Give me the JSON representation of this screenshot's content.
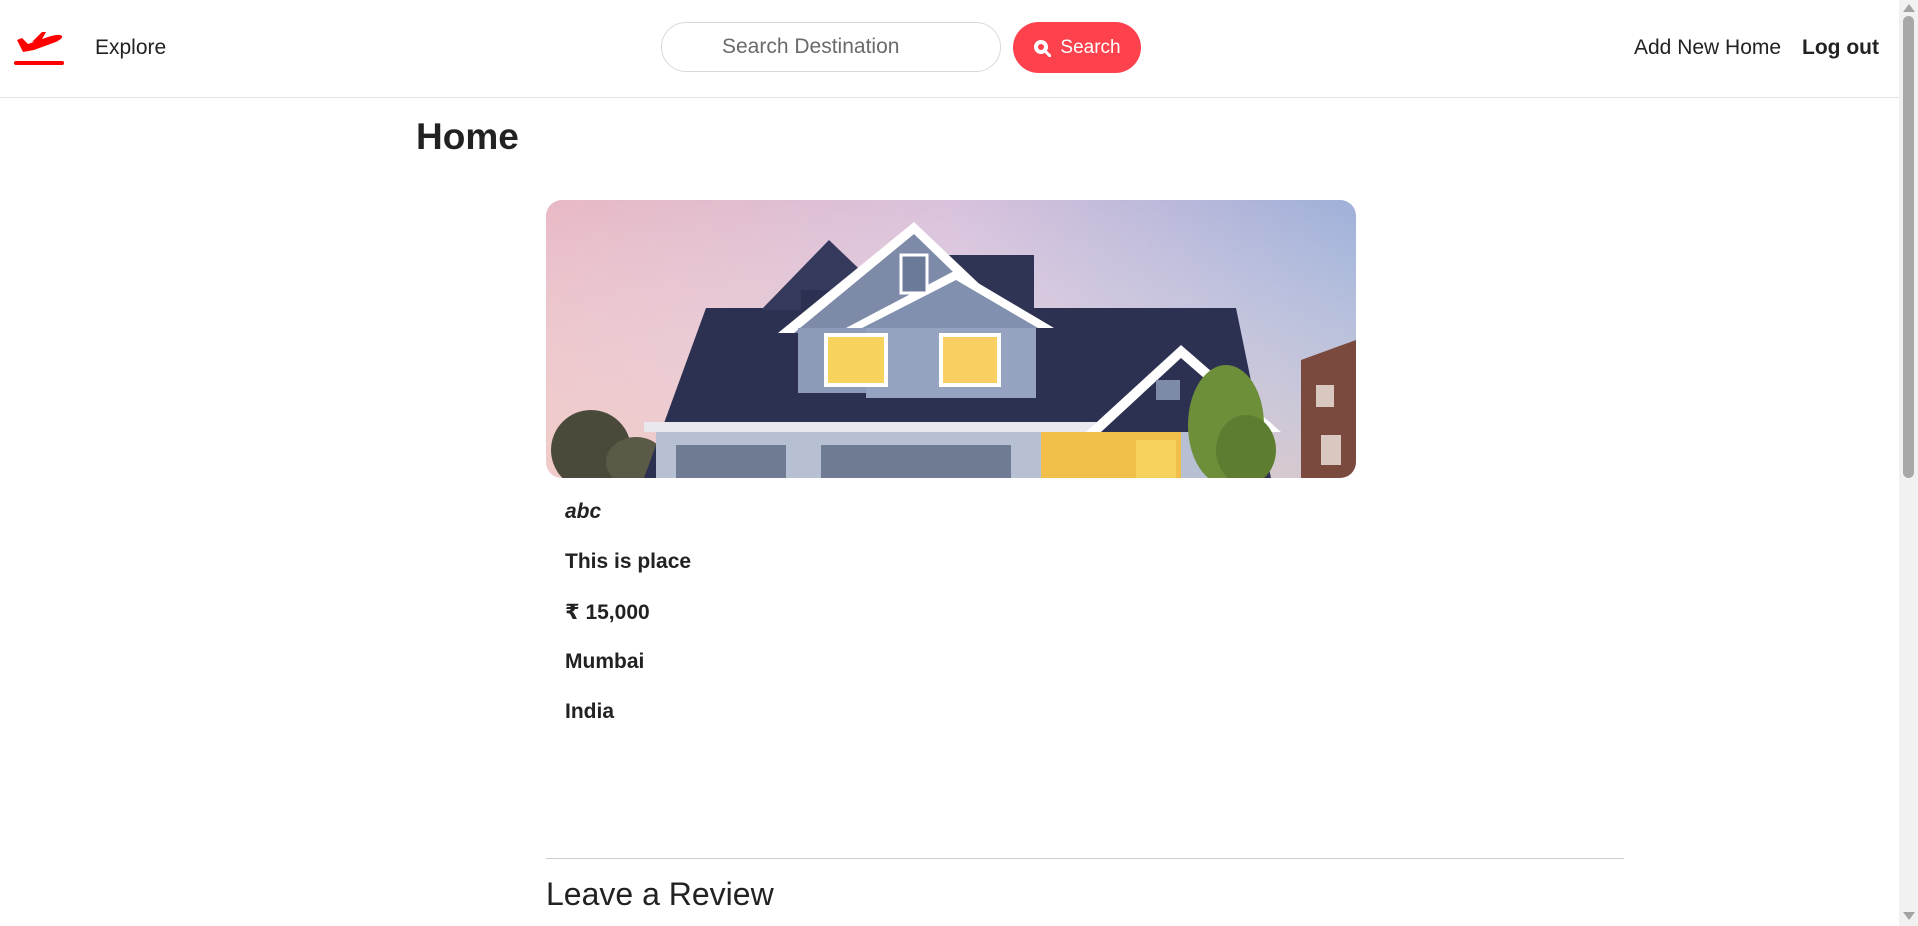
{
  "nav": {
    "explore_label": "Explore",
    "search_placeholder": "Search Destination",
    "search_button_label": "Search",
    "add_home_label": "Add New Home",
    "logout_label": "Log out",
    "brand_icon": "plane-icon",
    "brand_color": "#fe0000",
    "accent_color": "#fe424d"
  },
  "page": {
    "title": "Home"
  },
  "listing": {
    "image": "house-photo",
    "owner": "abc",
    "description": "This is place",
    "price": "₹ 15,000",
    "location": "Mumbai",
    "country": "India"
  },
  "review": {
    "heading": "Leave a Review"
  }
}
